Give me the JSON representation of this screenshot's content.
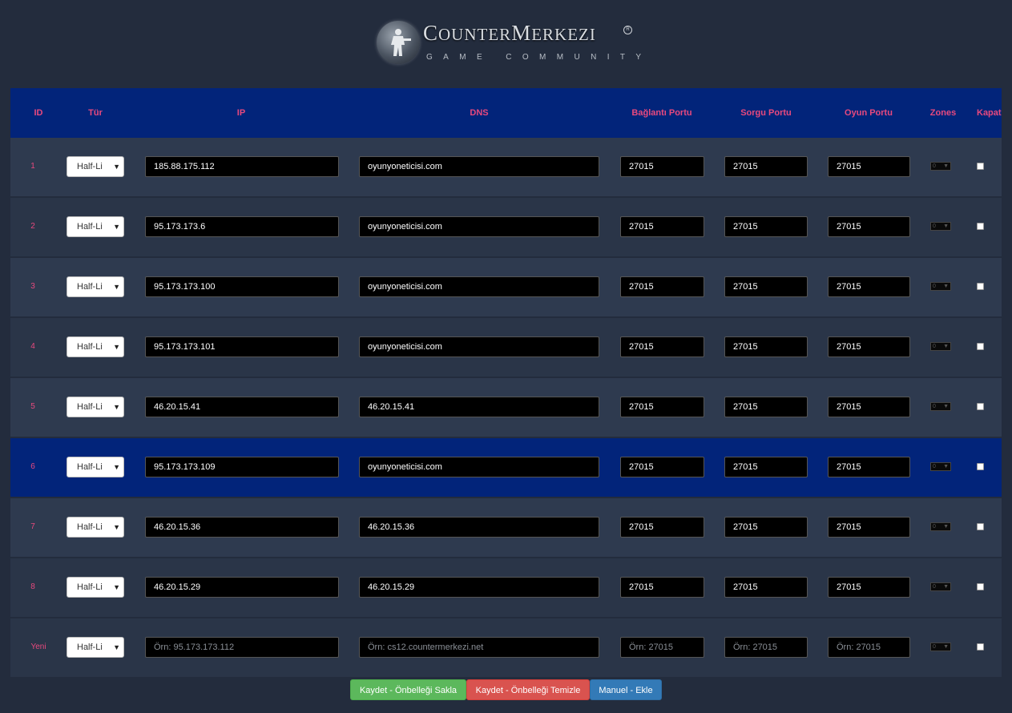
{
  "logo": {
    "title_c": "C",
    "title_ounter": "OUNTER",
    "title_m": "M",
    "title_erkezi": "ERKEZI",
    "subtitle": "GAME COMMUNITY"
  },
  "columns": {
    "id": "ID",
    "type": "Tür",
    "ip": "IP",
    "dns": "DNS",
    "conn_port": "Bağlantı Portu",
    "query_port": "Sorgu Portu",
    "game_port": "Oyun Portu",
    "zones": "Zones",
    "close": "Kapat"
  },
  "rows": [
    {
      "id": "1",
      "type": "Half-Li",
      "ip": "185.88.175.112",
      "dns": "oyunyoneticisi.com",
      "conn_port": "27015",
      "query_port": "27015",
      "game_port": "27015",
      "zones": "0"
    },
    {
      "id": "2",
      "type": "Half-Li",
      "ip": "95.173.173.6",
      "dns": "oyunyoneticisi.com",
      "conn_port": "27015",
      "query_port": "27015",
      "game_port": "27015",
      "zones": "0"
    },
    {
      "id": "3",
      "type": "Half-Li",
      "ip": "95.173.173.100",
      "dns": "oyunyoneticisi.com",
      "conn_port": "27015",
      "query_port": "27015",
      "game_port": "27015",
      "zones": "0"
    },
    {
      "id": "4",
      "type": "Half-Li",
      "ip": "95.173.173.101",
      "dns": "oyunyoneticisi.com",
      "conn_port": "27015",
      "query_port": "27015",
      "game_port": "27015",
      "zones": "0"
    },
    {
      "id": "5",
      "type": "Half-Li",
      "ip": "46.20.15.41",
      "dns": "46.20.15.41",
      "conn_port": "27015",
      "query_port": "27015",
      "game_port": "27015",
      "zones": "0"
    },
    {
      "id": "6",
      "type": "Half-Li",
      "ip": "95.173.173.109",
      "dns": "oyunyoneticisi.com",
      "conn_port": "27015",
      "query_port": "27015",
      "game_port": "27015",
      "zones": "0"
    },
    {
      "id": "7",
      "type": "Half-Li",
      "ip": "46.20.15.36",
      "dns": "46.20.15.36",
      "conn_port": "27015",
      "query_port": "27015",
      "game_port": "27015",
      "zones": "0"
    },
    {
      "id": "8",
      "type": "Half-Li",
      "ip": "46.20.15.29",
      "dns": "46.20.15.29",
      "conn_port": "27015",
      "query_port": "27015",
      "game_port": "27015",
      "zones": "0"
    }
  ],
  "new_row": {
    "id": "Yeni",
    "type": "Half-Li",
    "ip_placeholder": "Örn: 95.173.173.112",
    "dns_placeholder": "Örn: cs12.countermerkezi.net",
    "conn_port_placeholder": "Örn: 27015",
    "query_port_placeholder": "Örn: 27015",
    "game_port_placeholder": "Örn: 27015",
    "zones": "0"
  },
  "buttons": {
    "save_keep": "Kaydet - Önbelleği Sakla",
    "save_clear": "Kaydet - Önbelleği Temizle",
    "manual_add": "Manuel - Ekle"
  },
  "colors": {
    "page_bg": "#232c3d",
    "header_bg": "#02247a",
    "accent_pink": "#e8497e",
    "btn_green": "#5cb85c",
    "btn_red": "#d9534f",
    "btn_blue": "#337ab7"
  },
  "selected_row_index": 5
}
